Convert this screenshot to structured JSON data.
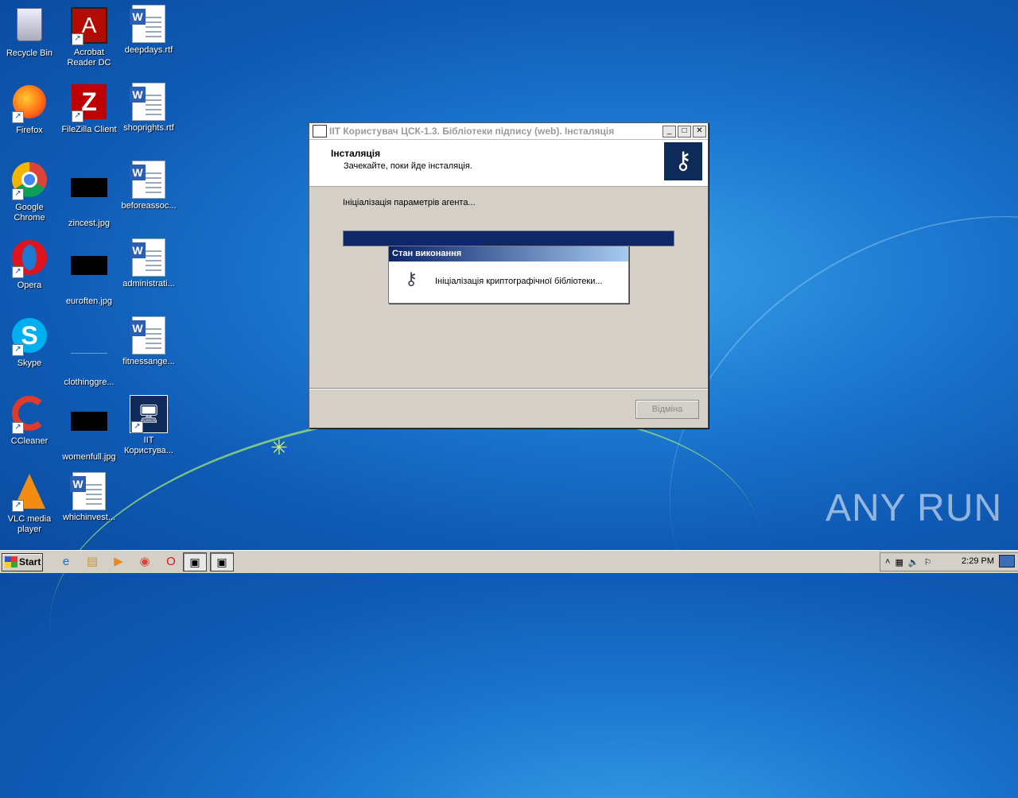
{
  "desktop": {
    "icons": [
      {
        "label": "Recycle Bin",
        "icon": "recycle-bin-icon"
      },
      {
        "label": "Acrobat Reader DC",
        "icon": "acrobat-icon"
      },
      {
        "label": "deepdays.rtf",
        "icon": "word-doc-icon"
      },
      {
        "label": "Firefox",
        "icon": "firefox-icon"
      },
      {
        "label": "FileZilla Client",
        "icon": "filezilla-icon"
      },
      {
        "label": "shoprights.rtf",
        "icon": "word-doc-icon"
      },
      {
        "label": "Google Chrome",
        "icon": "chrome-icon"
      },
      {
        "label": "zincest.jpg",
        "icon": "image-icon"
      },
      {
        "label": "beforeassoc...",
        "icon": "word-doc-icon"
      },
      {
        "label": "Opera",
        "icon": "opera-icon"
      },
      {
        "label": "euroften.jpg",
        "icon": "image-icon"
      },
      {
        "label": "administrati...",
        "icon": "word-doc-icon"
      },
      {
        "label": "Skype",
        "icon": "skype-icon"
      },
      {
        "label": "clothinggre...",
        "icon": "image-icon"
      },
      {
        "label": "fitnessange...",
        "icon": "word-doc-icon"
      },
      {
        "label": "CCleaner",
        "icon": "ccleaner-icon"
      },
      {
        "label": "womenfull.jpg",
        "icon": "image-icon"
      },
      {
        "label": "IIT Користува...",
        "icon": "iit-app-icon"
      },
      {
        "label": "VLC media player",
        "icon": "vlc-icon"
      },
      {
        "label": "whichinvest...",
        "icon": "word-doc-icon"
      }
    ]
  },
  "installer": {
    "title": "ІІТ Користувач ЦСК-1.3. Бібліотеки підпису (web). Інсталяція",
    "header_title": "Інсталяція",
    "header_subtitle": "Зачекайте, поки йде інсталяція.",
    "status_text": "Ініціалізація параметрів агента...",
    "progress": 1.0,
    "cancel_label": "Відміна"
  },
  "popup": {
    "title": "Стан виконання",
    "message": "Ініціалізація криптографічної бібліотеки..."
  },
  "taskbar": {
    "start_label": "Start",
    "clock": "2:29 PM"
  },
  "watermark": "ANY RUN"
}
